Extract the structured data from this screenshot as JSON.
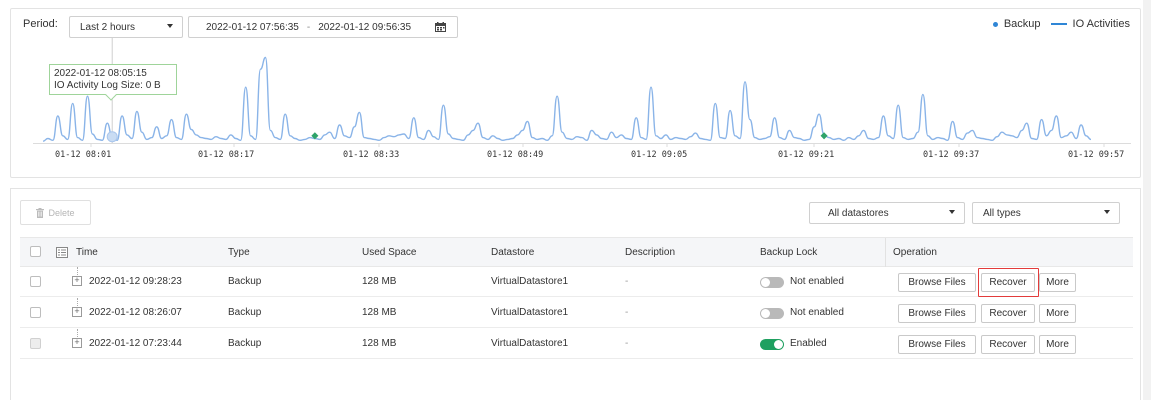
{
  "filter": {
    "period_label": "Period:",
    "period_value": "Last 2 hours",
    "range_start": "2022-01-12 07:56:35",
    "range_sep": "-",
    "range_end": "2022-01-12 09:56:35"
  },
  "legend": {
    "backup": "Backup",
    "io": "IO Activities"
  },
  "tooltip": {
    "line1": "2022-01-12 08:05:15",
    "line2": "IO Activity Log Size: 0 B"
  },
  "chart_data": {
    "type": "line",
    "x_ticks": [
      "01-12 08:01",
      "01-12 08:17",
      "01-12 08:33",
      "01-12 08:49",
      "01-12 09:05",
      "01-12 09:21",
      "01-12 09:37",
      "01-12 09:57"
    ],
    "series": [
      {
        "name": "IO Activities",
        "color": "#8ab4e8",
        "values": [
          2,
          5,
          3,
          30,
          8,
          4,
          44,
          6,
          3,
          52,
          10,
          4,
          3,
          22,
          7,
          3,
          30,
          9,
          5,
          35,
          12,
          4,
          6,
          18,
          5,
          8,
          26,
          6,
          4,
          32,
          15,
          9,
          6,
          5,
          4,
          7,
          5,
          4,
          9,
          5,
          3,
          62,
          8,
          4,
          82,
          95,
          14,
          6,
          4,
          32,
          8,
          5,
          3,
          4,
          6,
          5,
          4,
          9,
          12,
          5,
          20,
          8,
          6,
          18,
          34,
          6,
          5,
          4,
          3,
          6,
          8,
          7,
          9,
          10,
          5,
          28,
          6,
          4,
          14,
          7,
          4,
          42,
          10,
          5,
          4,
          3,
          9,
          14,
          22,
          6,
          4,
          8,
          5,
          3,
          4,
          5,
          9,
          14,
          24,
          6,
          4,
          5,
          3,
          8,
          52,
          12,
          5,
          4,
          7,
          6,
          3,
          14,
          9,
          5,
          4,
          12,
          6,
          9,
          5,
          4,
          28,
          6,
          4,
          62,
          8,
          5,
          9,
          4,
          6,
          5,
          4,
          7,
          11,
          5,
          4,
          3,
          44,
          6,
          5,
          36,
          8,
          5,
          68,
          26,
          6,
          4,
          5,
          7,
          28,
          6,
          4,
          14,
          6,
          5,
          3,
          4,
          18,
          32,
          9,
          6,
          4,
          5,
          3,
          6,
          4,
          8,
          14,
          5,
          4,
          6,
          30,
          8,
          5,
          42,
          6,
          4,
          5,
          12,
          54,
          8,
          4,
          6,
          5,
          3,
          24,
          6,
          4,
          11,
          14,
          6,
          5,
          4,
          3,
          7,
          12,
          9,
          8,
          6,
          14,
          22,
          5,
          4,
          26,
          8,
          14,
          30,
          6,
          8,
          12,
          5,
          20,
          8,
          4
        ]
      },
      {
        "name": "Backup",
        "color": "#2ea36a",
        "markers": [
          {
            "x_index": 55,
            "value": 8
          },
          {
            "x_index": 158,
            "value": 8
          }
        ]
      }
    ],
    "tooltip_x_index": 14
  },
  "toolbar": {
    "delete_label": "Delete",
    "datastore_filter": "All datastores",
    "type_filter": "All types"
  },
  "table": {
    "headers": [
      "Time",
      "Type",
      "Used Space",
      "Datastore",
      "Description",
      "Backup Lock",
      "Operation"
    ],
    "rows": [
      {
        "time": "2022-01-12 09:28:23",
        "type": "Backup",
        "used": "128 MB",
        "datastore": "VirtualDatastore1",
        "desc": "-",
        "lock": "Not enabled",
        "lock_on": false
      },
      {
        "time": "2022-01-12 08:26:07",
        "type": "Backup",
        "used": "128 MB",
        "datastore": "VirtualDatastore1",
        "desc": "-",
        "lock": "Not enabled",
        "lock_on": false
      },
      {
        "time": "2022-01-12 07:23:44",
        "type": "Backup",
        "used": "128 MB",
        "datastore": "VirtualDatastore1",
        "desc": "-",
        "lock": "Enabled",
        "lock_on": true
      }
    ],
    "ops": {
      "browse": "Browse Files",
      "recover": "Recover",
      "more": "More"
    }
  }
}
